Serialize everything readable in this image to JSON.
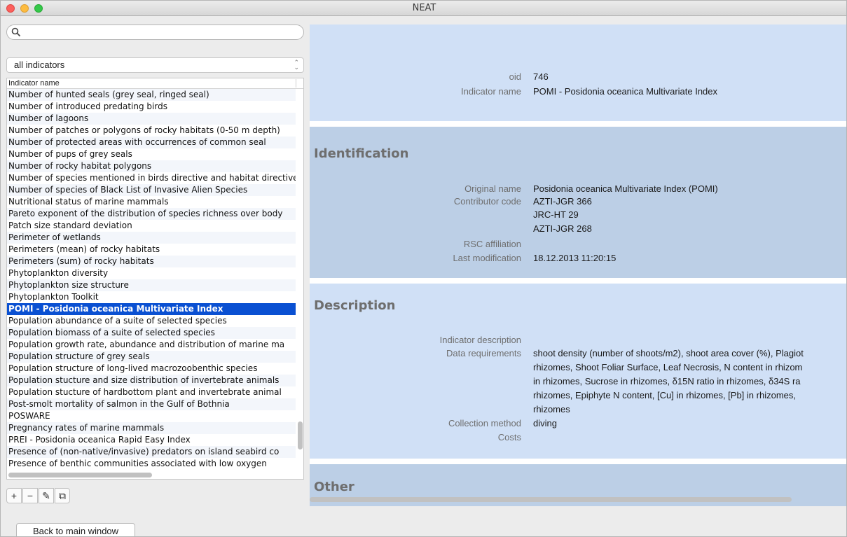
{
  "window": {
    "title": "NEAT"
  },
  "search": {
    "placeholder": ""
  },
  "filter": {
    "selected": "all indicators"
  },
  "list": {
    "header": "Indicator name",
    "items": [
      "Number of hunted seals (grey seal, ringed seal)",
      "Number of introduced predating birds",
      "Number of lagoons",
      "Number of patches or polygons of rocky habitats (0-50 m depth)",
      "Number of protected areas with occurrences of common seal",
      "Number of pups of grey seals",
      "Number of rocky habitat polygons",
      "Number of species mentioned in birds directive and habitat directive",
      "Number of species of Black List of Invasive Alien Species",
      "Nutritional status of marine mammals",
      "Pareto exponent of the distribution of species richness over body",
      "Patch size standard deviation",
      "Perimeter of wetlands",
      "Perimeters (mean) of rocky habitats",
      "Perimeters (sum) of rocky habitats",
      "Phytoplankton diversity",
      "Phytoplankton size structure",
      "Phytoplankton Toolkit",
      "POMI - Posidonia oceanica Multivariate Index",
      "Population abundance of a suite of selected species",
      "Population biomass of a suite of selected species",
      "Population growth rate, abundance and distribution of marine ma",
      "Population structure of grey seals",
      "Population structure of long-lived macrozoobenthic species",
      "Population stucture and size distribution of  invertebrate animals",
      "Population stucture of hardbottom plant and invertebrate animal",
      "Post-smolt mortality of salmon in the Gulf of Bothnia",
      "POSWARE",
      "Pregnancy rates of marine mammals",
      "PREI - Posidonia oceanica Rapid Easy Index",
      "Presence of (non-native/invasive) predators on island seabird co",
      "Presence of benthic communities associated with low oxygen"
    ],
    "selected_index": 18
  },
  "toolbar": {
    "add": "+",
    "remove": "−",
    "edit": "✎",
    "duplicate": "⧉"
  },
  "detail": {
    "header": {
      "oid_label": "oid",
      "oid": "746",
      "name_label": "Indicator name",
      "name": "POMI - Posidonia oceanica Multivariate Index"
    },
    "identification": {
      "title": "Identification",
      "original_name_label": "Original name",
      "original_name": "Posidonia oceanica Multivariate Index (POMI)",
      "contributor_label": "Contributor code",
      "contributor_codes": [
        "AZTI-JGR 366",
        "JRC-HT 29",
        "AZTI-JGR 268"
      ],
      "rsc_label": "RSC affiliation",
      "rsc": "",
      "lastmod_label": "Last modification",
      "lastmod": "18.12.2013   11:20:15"
    },
    "description": {
      "title": "Description",
      "desc_label": "Indicator description",
      "desc": "",
      "datareq_label": "Data requirements",
      "datareq_lines": [
        "shoot density (number of shoots/m2), shoot area cover (%), Plagiot",
        "rhizomes, Shoot Foliar Surface, Leaf Necrosis, N content in rhizom",
        "in rhizomes, Sucrose in rhizomes, δ15N ratio in rhizomes, δ34S ra",
        "rhizomes, Epiphyte N content, [Cu] in rhizomes, [Pb] in rhizomes,",
        "rhizomes"
      ],
      "method_label": "Collection method",
      "method": "diving",
      "costs_label": "Costs",
      "costs": ""
    },
    "other": {
      "title": "Other"
    }
  },
  "footer": {
    "back_label": "Back to main window"
  }
}
